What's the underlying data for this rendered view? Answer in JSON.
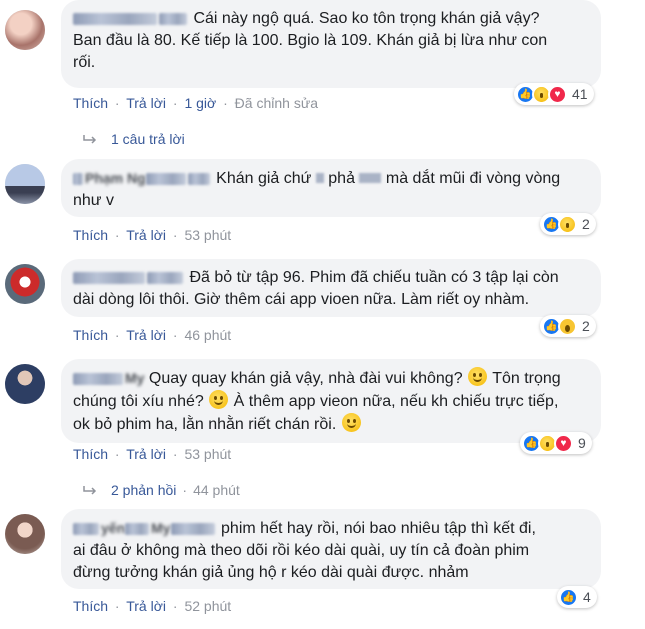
{
  "actions": {
    "like": "Thích",
    "reply": "Trả lời",
    "separator": "·",
    "edited": "Đã chỉnh sửa"
  },
  "colors": {
    "link": "#385898",
    "meta": "#90949c",
    "bubble": "#f2f3f5",
    "like": "#1877f2",
    "haha": "#f7c531",
    "love": "#f0284a"
  },
  "comments": [
    {
      "text_1": "Cái này ngộ quá. Sao ko tôn trọng khán giả vậy?",
      "text_2": "Ban đầu là 80. Kế tiếp là 100. Bgio là 109. Khán giả bị lừa như con",
      "text_3": "rối.",
      "time": "1 giờ",
      "reaction_count": "41",
      "reactions": [
        "like-icon",
        "haha-icon",
        "love-icon"
      ],
      "replies": "1 câu trả lời"
    },
    {
      "name": "Phạm Ng",
      "text_1": "Khán giả chứ",
      "text_1b": "phả",
      "text_1c": "mà dắt mũi đi vòng vòng",
      "text_2": "như v",
      "time": "53 phút",
      "reaction_count": "2",
      "reactions": [
        "like-icon",
        "haha-icon"
      ]
    },
    {
      "text_1": "Đã bỏ từ tập 96. Phim đã chiếu tuần có 3 tập lại còn",
      "text_2": "dài dòng lôi thôi. Giờ thêm cái app vioen nữa. Làm riết oy nhàm.",
      "time": "46 phút",
      "reaction_count": "2",
      "reactions": [
        "like-icon",
        "wow-icon"
      ]
    },
    {
      "name": "My",
      "text_1": "Quay quay khán giả vậy, nhà đài vui không?",
      "text_1b": "Tôn trọng",
      "text_2": "chúng tôi xíu nhé?",
      "text_2b": "À thêm app vieon nữa, nếu kh chiếu trực tiếp,",
      "text_3": "ok bỏ phim ha, lằn nhằn riết chán rồi.",
      "time": "53 phút",
      "reaction_count": "9",
      "reactions": [
        "like-icon",
        "haha-icon",
        "love-icon"
      ],
      "replies": "2 phản hồi",
      "replies_time": "44 phút"
    },
    {
      "name": "yến",
      "name_2": "My",
      "text_1": "phim hết hay rồi, nói bao nhiêu tập thì kết đi,",
      "text_2": "ai đâu ở không mà theo dõi rồi kéo dài quài, uy tín cả đoàn phim",
      "text_3": "đừng tưởng khán giả ủng hộ r kéo dài quài được. nhảm",
      "time": "52 phút",
      "reaction_count": "4",
      "reactions": [
        "like-icon"
      ]
    }
  ]
}
